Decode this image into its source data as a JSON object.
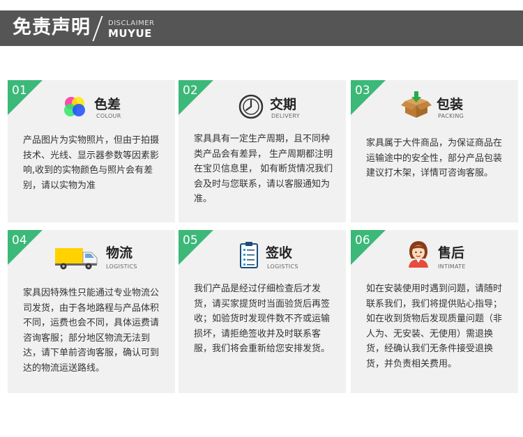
{
  "header": {
    "title": "免责声明",
    "subtitle_top": "DISCLAIMER",
    "subtitle_bottom": "MUYUE"
  },
  "cards": [
    {
      "num": "01",
      "title": "色差",
      "sub": "COLOUR",
      "icon": "color-wheel-icon",
      "text": "产品图片为实物照片，但由于拍摄技术、光线、显示器参数等因素影响,收到的实物颜色与照片会有差别，请以实物为准"
    },
    {
      "num": "02",
      "title": "交期",
      "sub": "DELIVERY",
      "icon": "clock-icon",
      "text": "家具具有一定生产周期，且不同种类产品会有差异， 生产周期都注明在宝贝信息里， 如有断货情况我们会及时与您联系，请以客服通知为准。"
    },
    {
      "num": "03",
      "title": "包装",
      "sub": "PACKING",
      "icon": "box-icon",
      "text": "家具属于大件商品，为保证商品在运输途中的安全性，部分产品包装建议打木架，详情可咨询客服。"
    },
    {
      "num": "04",
      "title": "物流",
      "sub": "LOGISTICS",
      "icon": "truck-icon",
      "text": "家具因特殊性只能通过专业物流公司发货，由于各地路程与产品体积不同，运费也会不同，具体运费请咨询客服；部分地区物流无法到达，请下单前咨询客服，确认可到达的物流运送路线。"
    },
    {
      "num": "05",
      "title": "签收",
      "sub": "LOGISTICS",
      "icon": "checklist-icon",
      "text": "我们产品是经过仔细检查后才发货，请买家提货时当面验货后再签收；如验货时发现件数不齐或运输损坏，请拒绝签收并及时联系客服，我们将会重新给您安排发货。"
    },
    {
      "num": "06",
      "title": "售后",
      "sub": "INTIMATE",
      "icon": "service-agent-icon",
      "text": "如在安装使用时遇到问题，请随时联系我们，我们将提供贴心指导；　如在收到货物后发现质量问题（非人为、无安装、无使用）需退换货，经确认我们无条件接受退换货，并负责相关费用。"
    }
  ],
  "colors": {
    "accent": "#3cb878",
    "header_bg": "#555555",
    "card_bg": "#f1f1f1"
  }
}
